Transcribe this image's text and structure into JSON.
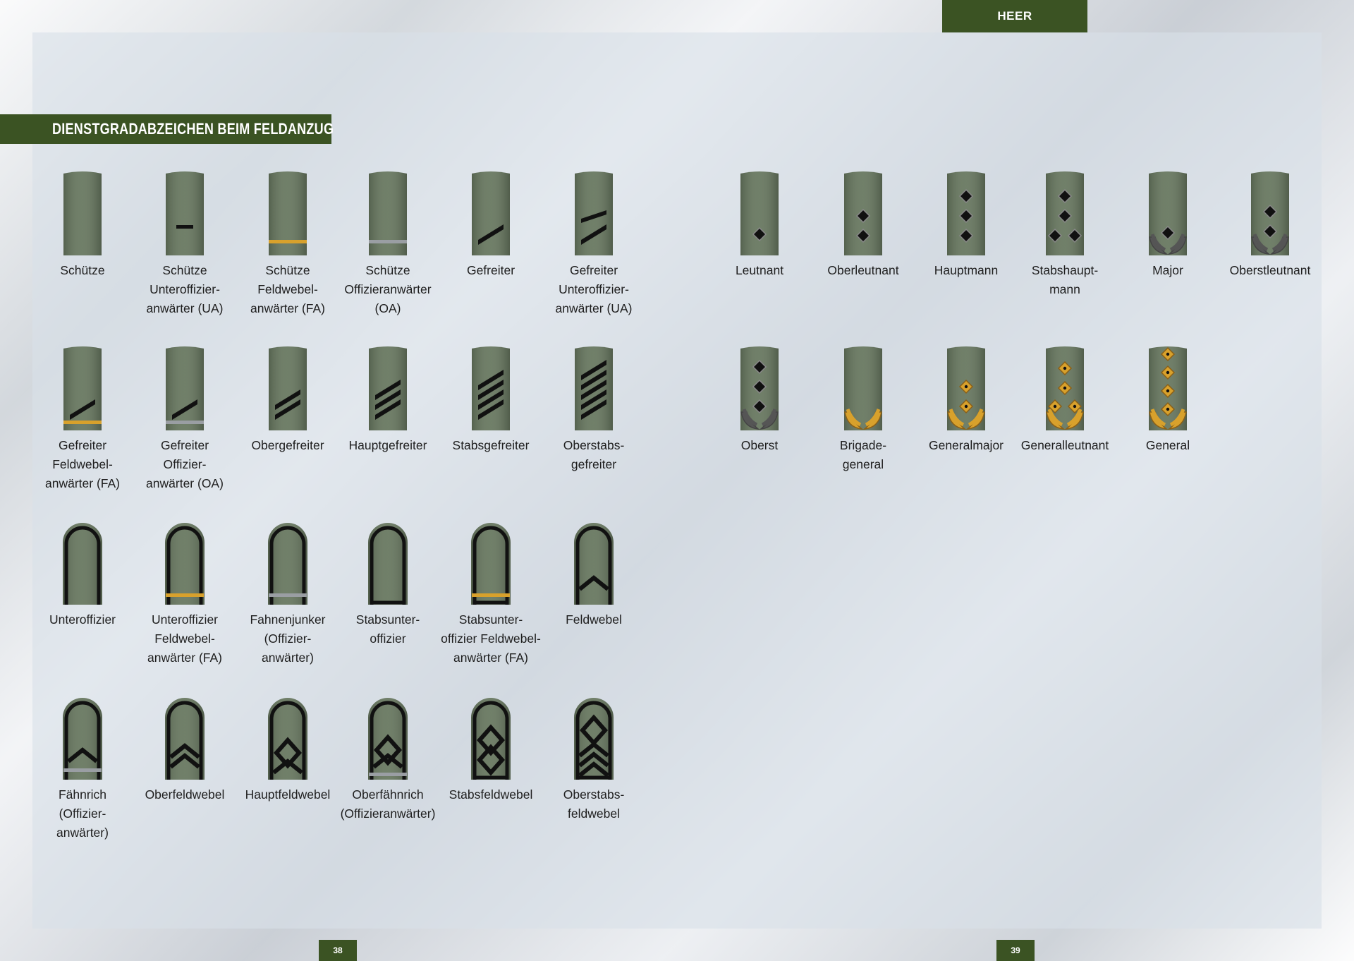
{
  "header": {
    "tab": "HEER"
  },
  "section": {
    "title": "DIENSTGRADABZEICHEN BEIM FELDANZUG"
  },
  "pages": {
    "left": "38",
    "right": "39"
  },
  "colors": {
    "green": "#3b5323",
    "strap": "#67775f",
    "gold": "#d8a12c",
    "silver": "#9a9ea3",
    "black": "#111111"
  },
  "ranks": [
    {
      "id": "schuetze",
      "label": "Schütze",
      "icon": "plain"
    },
    {
      "id": "schuetze-ua",
      "label": "Schütze\nUnteroffizier-\nanwärter (UA)",
      "icon": "bar"
    },
    {
      "id": "schuetze-fa",
      "label": "Schütze\nFeldwebel-\nanwärter (FA)",
      "icon": "gold-line"
    },
    {
      "id": "schuetze-oa",
      "label": "Schütze\nOffizieranwärter\n(OA)",
      "icon": "silver-line"
    },
    {
      "id": "gefreiter",
      "label": "Gefreiter",
      "icon": "stripe-1"
    },
    {
      "id": "gefreiter-ua",
      "label": "Gefreiter\nUnteroffizier-\nanwärter (UA)",
      "icon": "stripe-1-bar"
    },
    {
      "id": "gefreiter-fa",
      "label": "Gefreiter\nFeldwebel-\nanwärter (FA)",
      "icon": "stripe-1-gold"
    },
    {
      "id": "gefreiter-oa",
      "label": "Gefreiter\nOffizier-\nanwärter (OA)",
      "icon": "stripe-1-silver"
    },
    {
      "id": "obergefreiter",
      "label": "Obergefreiter",
      "icon": "stripe-2"
    },
    {
      "id": "hauptgefreiter",
      "label": "Hauptgefreiter",
      "icon": "stripe-3"
    },
    {
      "id": "stabsgefreiter",
      "label": "Stabsgefreiter",
      "icon": "stripe-4"
    },
    {
      "id": "oberstabsgefreiter",
      "label": "Oberstabs-\ngefreiter",
      "icon": "stripe-5"
    },
    {
      "id": "unteroffizier",
      "label": "Unteroffizier",
      "icon": "arch"
    },
    {
      "id": "unteroffizier-fa",
      "label": "Unteroffizier\nFeldwebel-\nanwärter (FA)",
      "icon": "arch-gold"
    },
    {
      "id": "fahnenjunker",
      "label": "Fahnenjunker\n(Offizier-\nanwärter)",
      "icon": "arch-silver"
    },
    {
      "id": "stabsunteroffizier",
      "label": "Stabsunter-\noffizier",
      "icon": "arch-closed"
    },
    {
      "id": "stabsunteroffizier-fa",
      "label": "Stabsunter-\noffizier Feldwebel-\nanwärter (FA)",
      "icon": "arch-closed-gold"
    },
    {
      "id": "feldwebel",
      "label": "Feldwebel",
      "icon": "arch-chev-1"
    },
    {
      "id": "faehnrich",
      "label": "Fähnrich\n(Offizier-\nanwärter)",
      "icon": "arch-chev-1-silver"
    },
    {
      "id": "oberfeldwebel",
      "label": "Oberfeldwebel",
      "icon": "arch-chev-2"
    },
    {
      "id": "hauptfeldwebel",
      "label": "Hauptfeldwebel",
      "icon": "arch-x"
    },
    {
      "id": "oberfaehnrich",
      "label": "Oberfähnrich\n(Offizieranwärter)",
      "icon": "arch-x-silver"
    },
    {
      "id": "stabsfeldwebel",
      "label": "Stabsfeldwebel",
      "icon": "arch-x-2"
    },
    {
      "id": "oberstabsfeldwebel",
      "label": "Oberstabs-\nfeldwebel",
      "icon": "arch-x-3"
    },
    {
      "id": "leutnant",
      "label": "Leutnant",
      "icon": "star-1"
    },
    {
      "id": "oberleutnant",
      "label": "Oberleutnant",
      "icon": "star-2"
    },
    {
      "id": "hauptmann",
      "label": "Hauptmann",
      "icon": "star-3"
    },
    {
      "id": "stabshauptmann",
      "label": "Stabshaupt-\nmann",
      "icon": "star-4"
    },
    {
      "id": "major",
      "label": "Major",
      "icon": "oak-1"
    },
    {
      "id": "oberstleutnant",
      "label": "Oberstleutnant",
      "icon": "oak-2"
    },
    {
      "id": "oberst",
      "label": "Oberst",
      "icon": "oak-3"
    },
    {
      "id": "brigadegeneral",
      "label": "Brigade-\ngeneral",
      "icon": "gold-oak-0"
    },
    {
      "id": "generalmajor",
      "label": "Generalmajor",
      "icon": "gold-oak-2"
    },
    {
      "id": "generalleutnant",
      "label": "Generalleutnant",
      "icon": "gold-oak-3"
    },
    {
      "id": "general",
      "label": "General",
      "icon": "gold-oak-4"
    }
  ]
}
